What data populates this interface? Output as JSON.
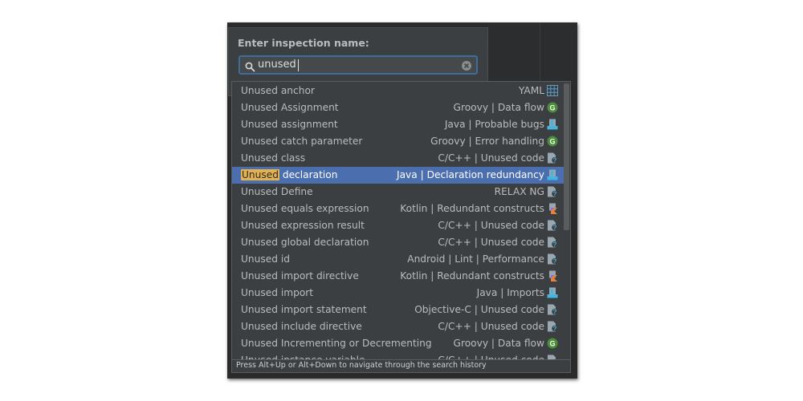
{
  "dialog": {
    "title": "Enter inspection name:",
    "search_value": "unused",
    "search_icon": "magnifier-icon",
    "clear_icon": "clear-circle-icon"
  },
  "results": [
    {
      "prefix": "Unused",
      "rest": " anchor",
      "category": "YAML",
      "icon": "table-icon",
      "selected": false
    },
    {
      "prefix": "Unused",
      "rest": " Assignment",
      "category": "Groovy | Data flow",
      "icon": "groovy-icon",
      "selected": false
    },
    {
      "prefix": "Unused",
      "rest": " assignment",
      "category": "Java | Probable bugs",
      "icon": "java-icon",
      "selected": false
    },
    {
      "prefix": "Unused",
      "rest": " catch parameter",
      "category": "Groovy | Error handling",
      "icon": "groovy-icon",
      "selected": false
    },
    {
      "prefix": "Unused",
      "rest": " class",
      "category": "C/C++ | Unused code",
      "icon": "unknown-file-icon",
      "selected": false
    },
    {
      "prefix": "Unused",
      "rest": " declaration",
      "category": "Java | Declaration redundancy",
      "icon": "java-icon",
      "selected": true
    },
    {
      "prefix": "Unused",
      "rest": " Define",
      "category": "RELAX NG",
      "icon": "unknown-file-icon",
      "selected": false
    },
    {
      "prefix": "Unused",
      "rest": " equals expression",
      "category": "Kotlin | Redundant constructs",
      "icon": "kotlin-icon",
      "selected": false
    },
    {
      "prefix": "Unused",
      "rest": " expression result",
      "category": "C/C++ | Unused code",
      "icon": "unknown-file-icon",
      "selected": false
    },
    {
      "prefix": "Unused",
      "rest": " global declaration",
      "category": "C/C++ | Unused code",
      "icon": "unknown-file-icon",
      "selected": false
    },
    {
      "prefix": "Unused",
      "rest": " id",
      "category": "Android | Lint | Performance",
      "icon": "unknown-file-icon",
      "selected": false
    },
    {
      "prefix": "Unused",
      "rest": " import directive",
      "category": "Kotlin | Redundant constructs",
      "icon": "kotlin-icon",
      "selected": false
    },
    {
      "prefix": "Unused",
      "rest": " import",
      "category": "Java | Imports",
      "icon": "java-icon",
      "selected": false
    },
    {
      "prefix": "Unused",
      "rest": " import statement",
      "category": "Objective-C | Unused code",
      "icon": "unknown-file-icon",
      "selected": false
    },
    {
      "prefix": "Unused",
      "rest": " include directive",
      "category": "C/C++ | Unused code",
      "icon": "unknown-file-icon",
      "selected": false
    },
    {
      "prefix": "Unused",
      "rest": " Incrementing or Decrementing",
      "category": "Groovy | Data flow",
      "icon": "groovy-icon",
      "selected": false
    },
    {
      "prefix": "Unused",
      "rest": " instance variable",
      "category": "C/C++ | Unused code",
      "icon": "unknown-file-icon",
      "selected": false
    }
  ],
  "footer": {
    "hint": "Press Alt+Up or Alt+Down to navigate through the search history"
  }
}
